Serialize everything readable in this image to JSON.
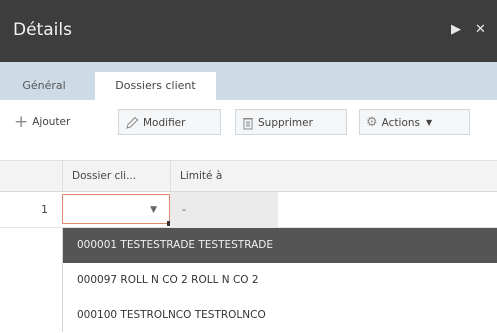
{
  "panel": {
    "title": "Détails"
  },
  "tabs": [
    {
      "label": "Général",
      "active": false
    },
    {
      "label": "Dossiers client",
      "active": true
    }
  ],
  "toolbar": {
    "add": {
      "label": "Ajouter",
      "icon": "plus-icon"
    },
    "edit": {
      "label": "Modifier",
      "icon": "pencil-icon"
    },
    "delete": {
      "label": "Supprimer",
      "icon": "trash-icon"
    },
    "actions": {
      "label": "Actions",
      "icon": "gear-icon"
    }
  },
  "grid": {
    "columns": [
      "Dossier cli...",
      "Limité à"
    ],
    "rows": [
      {
        "num": "1",
        "dossier": "",
        "limite": "-"
      }
    ]
  },
  "dropdown": {
    "options": [
      "000001 TESTESTRADE TESTESTRADE",
      "000097 ROLL N CO 2 ROLL N CO 2",
      "000100 TESTROLNCO TESTROLNCO"
    ],
    "highlighted_index": 0
  },
  "colors": {
    "titlebar": "#3d3d3d",
    "tabbar": "#cddbe7",
    "highlight": "#555555",
    "focus_border": "#e08a6e"
  }
}
